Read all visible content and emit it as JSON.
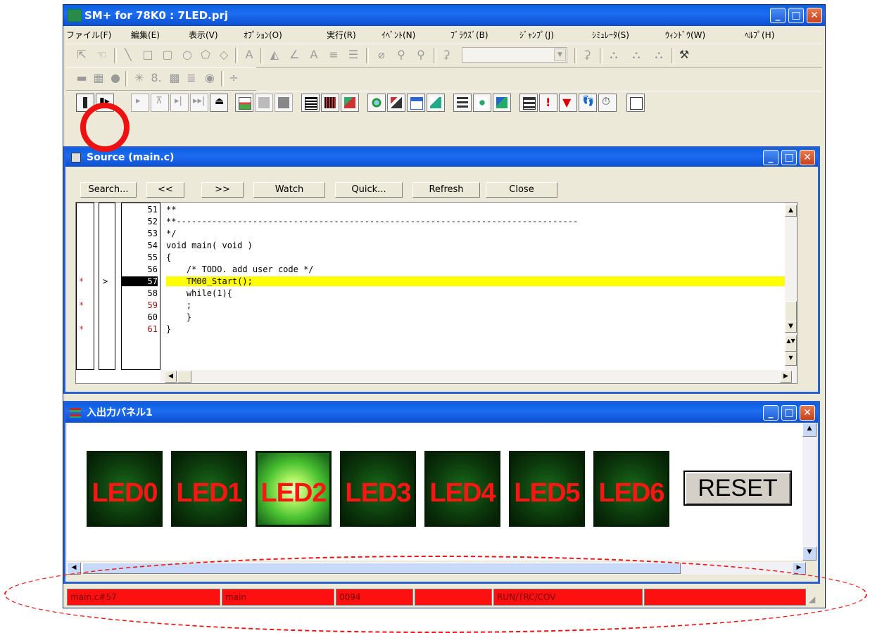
{
  "app": {
    "title": "SM+ for 78K0 : 7LED.prj"
  },
  "menu": [
    "ファイル(F)",
    "編集(E)",
    "表示(V)",
    "ｵﾌﾟｼｮﾝ(O)",
    "実行(R)",
    "ｲﾍﾞﾝﾄ(N)",
    "ﾌﾞﾗｳｽﾞ(B)",
    "ｼﾞｬﾝﾌﾟ(J)",
    "ｼﾐｭﾚｰﾀ(S)",
    "ｳｨﾝﾄﾞｳ(W)",
    "ﾍﾙﾌﾟ(H)"
  ],
  "source_window": {
    "title": "Source (main.c)",
    "buttons": [
      "Search...",
      "<<",
      ">>",
      "Watch",
      "Quick...",
      "Refresh",
      "Close"
    ],
    "lines": [
      {
        "num": "51",
        "text": "**",
        "mark": "",
        "arrow": "",
        "current": false,
        "red": false
      },
      {
        "num": "52",
        "text": "**-------------------------------------------------------------------------------",
        "mark": "",
        "arrow": "",
        "current": false,
        "red": false
      },
      {
        "num": "53",
        "text": "*/",
        "mark": "",
        "arrow": "",
        "current": false,
        "red": false
      },
      {
        "num": "54",
        "text": "void main( void )",
        "mark": "",
        "arrow": "",
        "current": false,
        "red": false
      },
      {
        "num": "55",
        "text": "{",
        "mark": "",
        "arrow": "",
        "current": false,
        "red": false
      },
      {
        "num": "56",
        "text": "    /* TODO. add user code */",
        "mark": "",
        "arrow": "",
        "current": false,
        "red": false
      },
      {
        "num": "57",
        "text": "    TM00_Start();",
        "mark": "*",
        "arrow": ">",
        "current": true,
        "red": false
      },
      {
        "num": "58",
        "text": "    while(1){",
        "mark": "",
        "arrow": "",
        "current": false,
        "red": false
      },
      {
        "num": "59",
        "text": "    ;",
        "mark": "*",
        "arrow": "",
        "current": false,
        "red": true
      },
      {
        "num": "60",
        "text": "    }",
        "mark": "",
        "arrow": "",
        "current": false,
        "red": false
      },
      {
        "num": "61",
        "text": "}",
        "mark": "*",
        "arrow": "",
        "current": false,
        "red": true
      }
    ]
  },
  "io_panel": {
    "title": "入出力パネル1",
    "leds": [
      {
        "label": "LED0",
        "on": false
      },
      {
        "label": "LED1",
        "on": false
      },
      {
        "label": "LED2",
        "on": true
      },
      {
        "label": "LED3",
        "on": false
      },
      {
        "label": "LED4",
        "on": false
      },
      {
        "label": "LED5",
        "on": false
      },
      {
        "label": "LED6",
        "on": false
      }
    ],
    "reset_label": "RESET"
  },
  "status_bar": [
    "main.c#57",
    "main",
    "0094",
    "",
    "RUN/TRC/COV",
    ""
  ],
  "colors": {
    "titlebar": "#0a5fe0",
    "highlight_line": "#ffff00",
    "status_bg": "#ff1010",
    "annotation": "#ee1111",
    "led_text": "#ff1414"
  }
}
